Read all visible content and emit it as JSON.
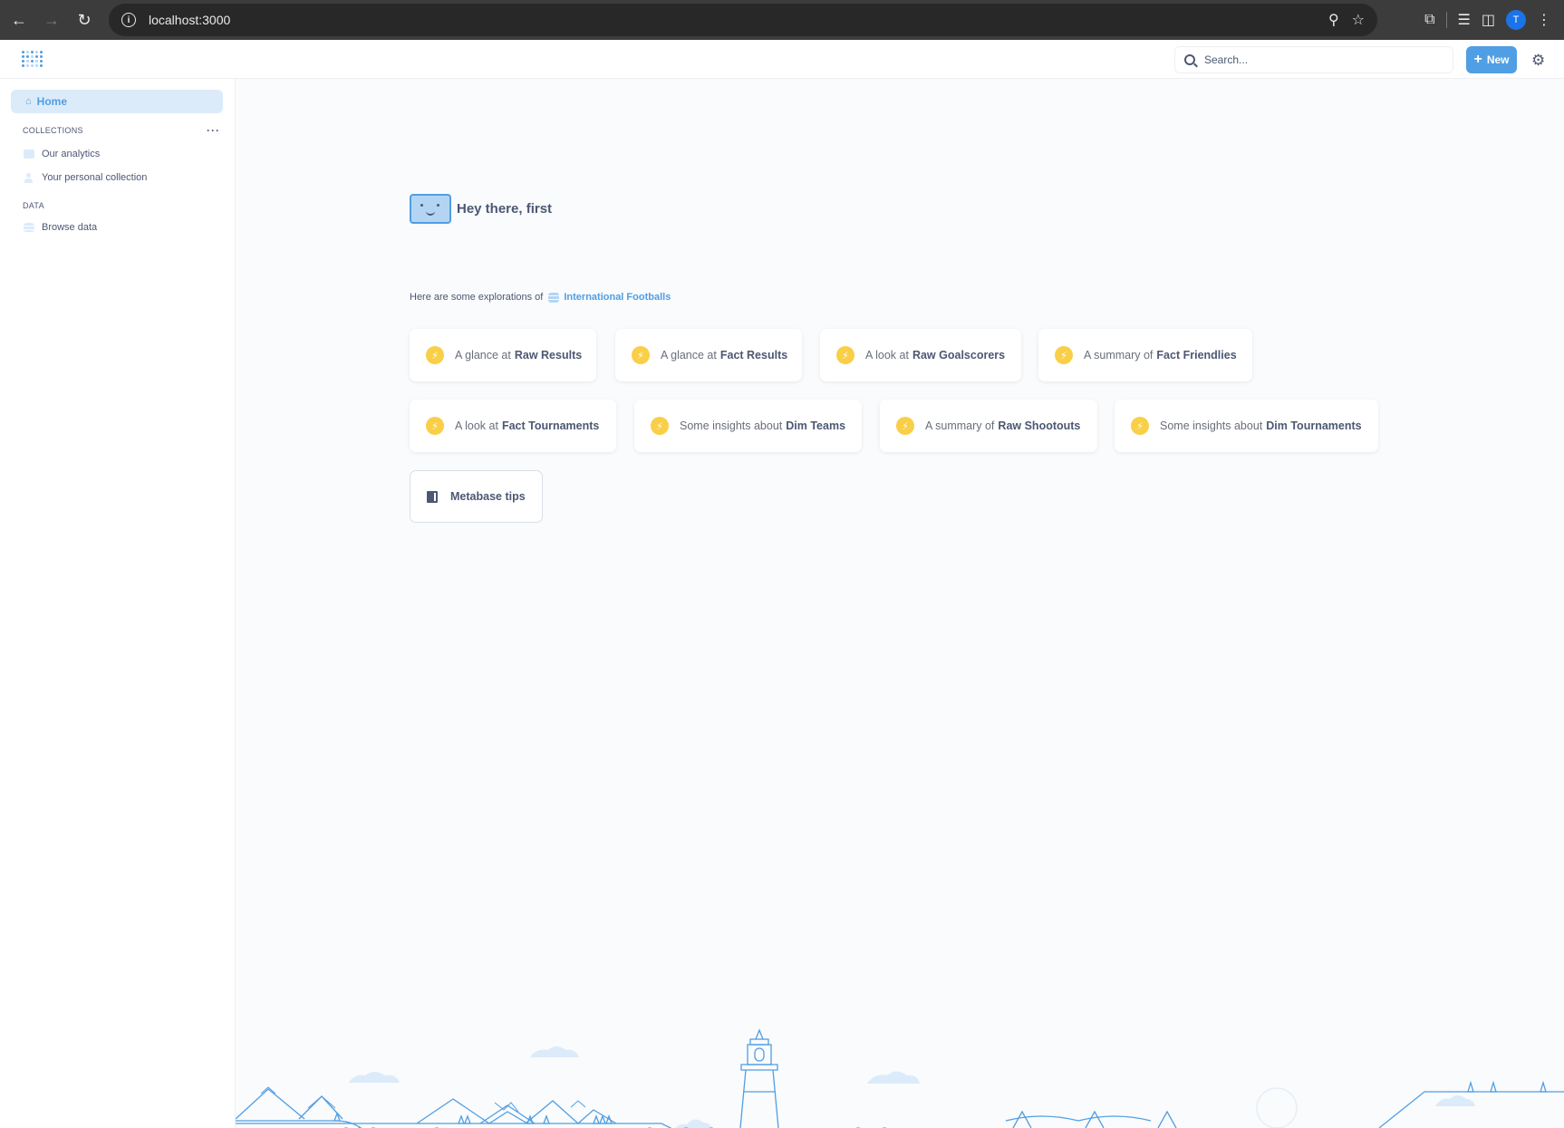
{
  "browser": {
    "url": "localhost:3000",
    "profile_initial": "T"
  },
  "header": {
    "search_placeholder": "Search...",
    "new_label": "New"
  },
  "sidebar": {
    "home_label": "Home",
    "collections_heading": "COLLECTIONS",
    "collections": [
      {
        "label": "Our analytics",
        "icon": "folder-icon"
      },
      {
        "label": "Your personal collection",
        "icon": "person-icon"
      }
    ],
    "data_heading": "DATA",
    "browse_data_label": "Browse data"
  },
  "main": {
    "greeting": "Hey there, first",
    "explorations_prefix": "Here are some explorations of",
    "database_name": "International Footballs",
    "cards": [
      {
        "prefix": "A glance at",
        "name": "Raw Results"
      },
      {
        "prefix": "A glance at",
        "name": "Fact Results"
      },
      {
        "prefix": "A look at",
        "name": "Raw Goalscorers"
      },
      {
        "prefix": "A summary of",
        "name": "Fact Friendlies"
      },
      {
        "prefix": "A look at",
        "name": "Fact Tournaments"
      },
      {
        "prefix": "Some insights about",
        "name": "Dim Teams"
      },
      {
        "prefix": "A summary of",
        "name": "Raw Shootouts"
      },
      {
        "prefix": "Some insights about",
        "name": "Dim Tournaments"
      }
    ],
    "tips_label": "Metabase tips"
  },
  "colors": {
    "brand": "#509ee3",
    "text": "#4c5773",
    "bolt": "#f9cf48",
    "background": "#f9fbfc"
  }
}
